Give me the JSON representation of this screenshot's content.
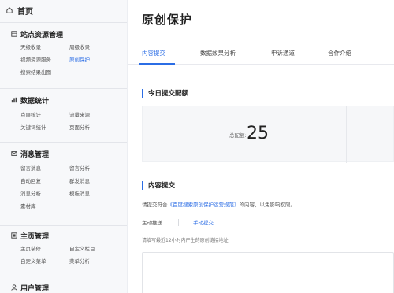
{
  "sidebar": {
    "home": "首页",
    "sections": [
      {
        "title": "站点资源管理",
        "items": [
          "天级收录",
          "周级收录",
          "视频资源服务",
          "原创保护",
          "搜索结果出图"
        ]
      },
      {
        "title": "数据统计",
        "items": [
          "点展统计",
          "流量来源",
          "关键词统计",
          "页面分析"
        ]
      },
      {
        "title": "消息管理",
        "items": [
          "留言消息",
          "留言分析",
          "自动回复",
          "群发消息",
          "消息分析",
          "模板消息",
          "素材库"
        ]
      },
      {
        "title": "主页管理",
        "items": [
          "主页装修",
          "自定义栏目",
          "自定义菜单",
          "菜单分析"
        ]
      },
      {
        "title": "用户管理",
        "items": []
      }
    ]
  },
  "main": {
    "title": "原创保护",
    "tabs": [
      "内容提交",
      "数据效果分析",
      "申诉通道",
      "合作介绍"
    ],
    "active_tab": 0,
    "today_section_title": "今日提交配额",
    "stats": {
      "label": "总配额",
      "value": "25"
    },
    "content_section_title": "内容提交",
    "note_prefix": "请提交符合",
    "note_link": "《百度搜索原创保护运营规范》",
    "note_suffix": "的内容，以免影响权限。",
    "submit_modes": {
      "auto": "主动推送",
      "manual": "手动提交"
    },
    "textarea_hint": "请填写最近12小时内产生的原创链接地址"
  },
  "colors": {
    "accent": "#2b6de5",
    "sidebar_bg": "#f7f8fa"
  },
  "icons": [
    "home-icon",
    "site-icon",
    "stats-icon",
    "message-icon",
    "homepage-icon",
    "user-icon"
  ]
}
